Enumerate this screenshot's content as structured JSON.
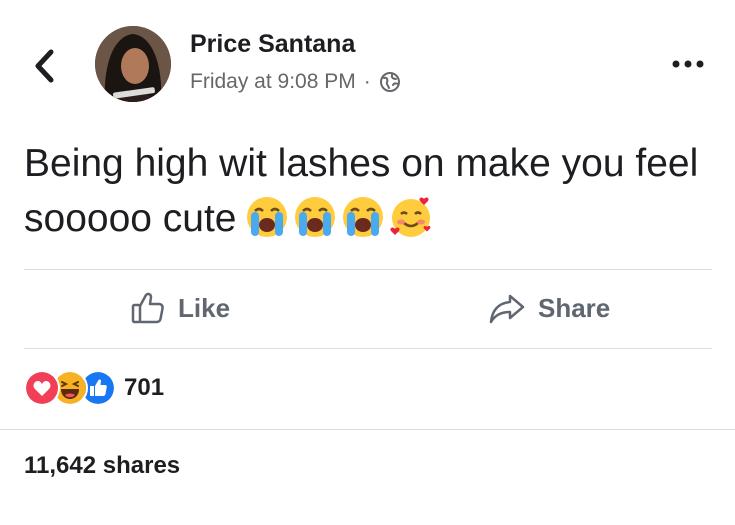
{
  "post": {
    "author": "Price Santana",
    "time": "Friday at 9:08 PM",
    "separator": "·",
    "privacy_icon": "globe-icon",
    "text": "Being high wit lashes on make you feel sooooo cute",
    "emojis": [
      "loudly-crying-face-emoji",
      "loudly-crying-face-emoji",
      "loudly-crying-face-emoji",
      "smiling-face-with-hearts-emoji"
    ]
  },
  "actions": {
    "like_label": "Like",
    "share_label": "Share"
  },
  "reactions": {
    "icons": [
      "love-reaction-icon",
      "haha-reaction-icon",
      "like-reaction-icon"
    ],
    "count": "701"
  },
  "shares": "11,642 shares",
  "colors": {
    "name": "#1c1e21",
    "meta": "#65676b",
    "action": "#606770",
    "divider": "#dadde1",
    "love": "#f33e58",
    "like": "#1877f2",
    "haha": "#f7b125"
  }
}
